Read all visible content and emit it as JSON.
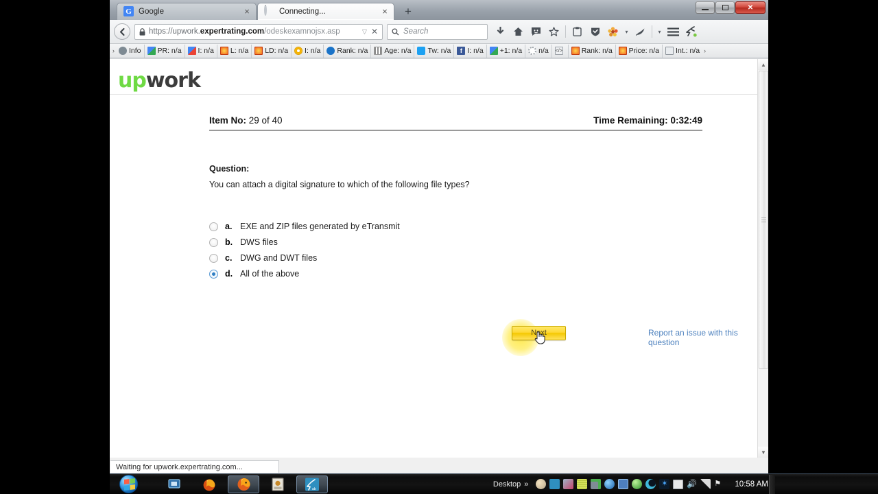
{
  "browser": {
    "tabs": [
      {
        "title": "Google",
        "favicon": "google-favicon",
        "active": false,
        "close_label": "×"
      },
      {
        "title": "Connecting...",
        "favicon": "loading-spinner",
        "active": true,
        "close_label": "×"
      }
    ],
    "new_tab_label": "+",
    "window_controls": {
      "minimize": "–",
      "restore": "❐",
      "close": "✕"
    },
    "back_label": "←",
    "url": {
      "scheme": "https://upwork.",
      "domain": "expertrating.com",
      "path": "/odeskexamnojsx.asp",
      "full": "https://upwork.expertrating.com/odeskexamnojsx.asp",
      "lock_icon": "🔒",
      "dropdown_icon": "▽",
      "stop_icon": "✕"
    },
    "search": {
      "placeholder": "Search",
      "icon": "search-icon"
    },
    "toolbar_icons": [
      "downloads-icon",
      "home-icon",
      "chat-icon",
      "bookmark-star-icon",
      "clipboard-icon",
      "shield-icon",
      "addon-flower-icon",
      "dropdown-caret",
      "feather-icon",
      "dropdown-caret-2",
      "hamburger-menu-icon",
      "runner-icon"
    ],
    "bookmarks": [
      {
        "label": "Info",
        "color": "#7e8a93"
      },
      {
        "label": "PR: n/a",
        "color": "#4285f4"
      },
      {
        "label": "I: n/a",
        "color": "#4285f4"
      },
      {
        "label": "L: n/a",
        "color": "#f26522"
      },
      {
        "label": "LD: n/a",
        "color": "#f26522"
      },
      {
        "label": "I: n/a",
        "color": "#f5a623"
      },
      {
        "label": "Rank: n/a",
        "color": "#1a73c8"
      },
      {
        "label": "Age: n/a",
        "color": "#8b8b8b"
      },
      {
        "label": "Tw: n/a",
        "color": "#1da1f2"
      },
      {
        "label": "I: n/a",
        "color": "#3b5998"
      },
      {
        "label": "+1: n/a",
        "color": "#4285f4"
      },
      {
        "label": "n/a",
        "color": "#9aa0a6"
      },
      {
        "label": "",
        "color": "#c9ced3"
      },
      {
        "label": "Rank: n/a",
        "color": "#f26522"
      },
      {
        "label": "Price: n/a",
        "color": "#f26522"
      },
      {
        "label": "Int.: n/a",
        "color": "#6f7780"
      }
    ],
    "bookmarks_overflow": "›",
    "status_text": "Waiting for upwork.expertrating.com..."
  },
  "page": {
    "logo": {
      "part1": "up",
      "part2": "work",
      "accent": "#6fda44"
    },
    "header": {
      "item_label": "Item No:",
      "item_value": "29 of 40",
      "time_label": "Time Remaining:",
      "time_value": "0:32:49"
    },
    "question": {
      "label": "Question:",
      "text": "You can attach a digital signature to which of the following file types?"
    },
    "options": [
      {
        "letter": "a.",
        "text": "EXE and ZIP files generated by eTransmit",
        "selected": false
      },
      {
        "letter": "b.",
        "text": "DWS files",
        "selected": false
      },
      {
        "letter": "c.",
        "text": "DWG and DWT files",
        "selected": false
      },
      {
        "letter": "d.",
        "text": "All of the above",
        "selected": true
      }
    ],
    "next_button": "Next",
    "report_link": "Report an issue with this question"
  },
  "taskbar": {
    "start_label": "start-orb",
    "items": [
      "window-switcher-icon",
      "firefox-dev-icon",
      "firefox-icon",
      "photo-icon",
      "acrobat-icon"
    ],
    "desktop_label": "Desktop",
    "overflow_label": "»",
    "tray_icons": [
      "moon-icon",
      "runner-icon",
      "paint-icon",
      "notepad-icon",
      "usb-safe-icon",
      "globe-icon",
      "dictionary-icon",
      "green-ball-icon",
      "crescent-icon",
      "bluetooth-icon",
      "battery-icon",
      "volume-icon",
      "network-icon",
      "flag-icon"
    ],
    "clock": "10:58 AM"
  }
}
